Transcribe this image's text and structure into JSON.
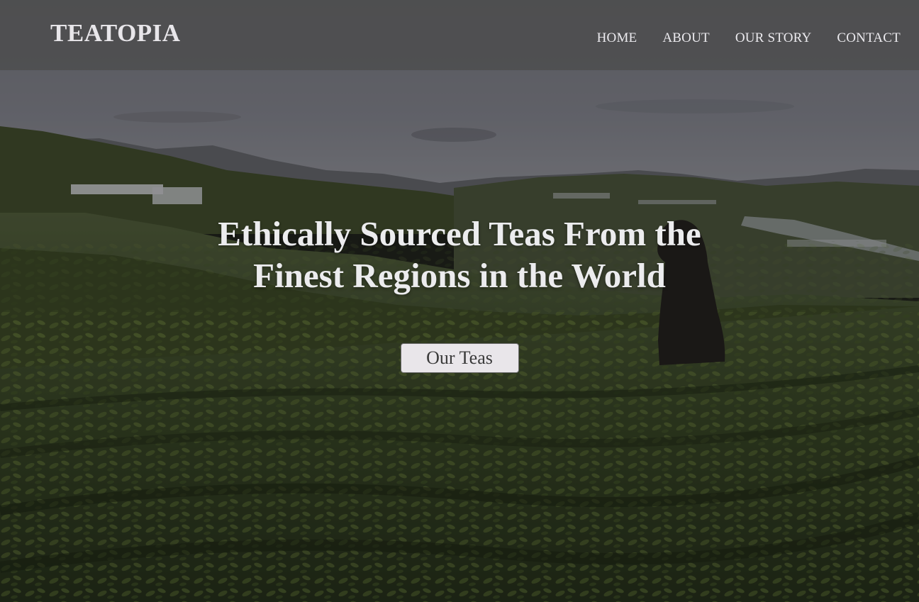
{
  "header": {
    "brand": "TEATOPIA",
    "nav": [
      {
        "label": "HOME"
      },
      {
        "label": "ABOUT"
      },
      {
        "label": "OUR STORY"
      },
      {
        "label": "CONTACT"
      }
    ]
  },
  "hero": {
    "title": "Ethically Sourced Teas From the Finest Regions in the World",
    "cta_label": "Our Teas"
  },
  "colors": {
    "header_bg": "#4b4b4b",
    "text_light": "#ececee",
    "button_bg": "#e9e6ea",
    "tea_green": "#2c3a1c"
  }
}
